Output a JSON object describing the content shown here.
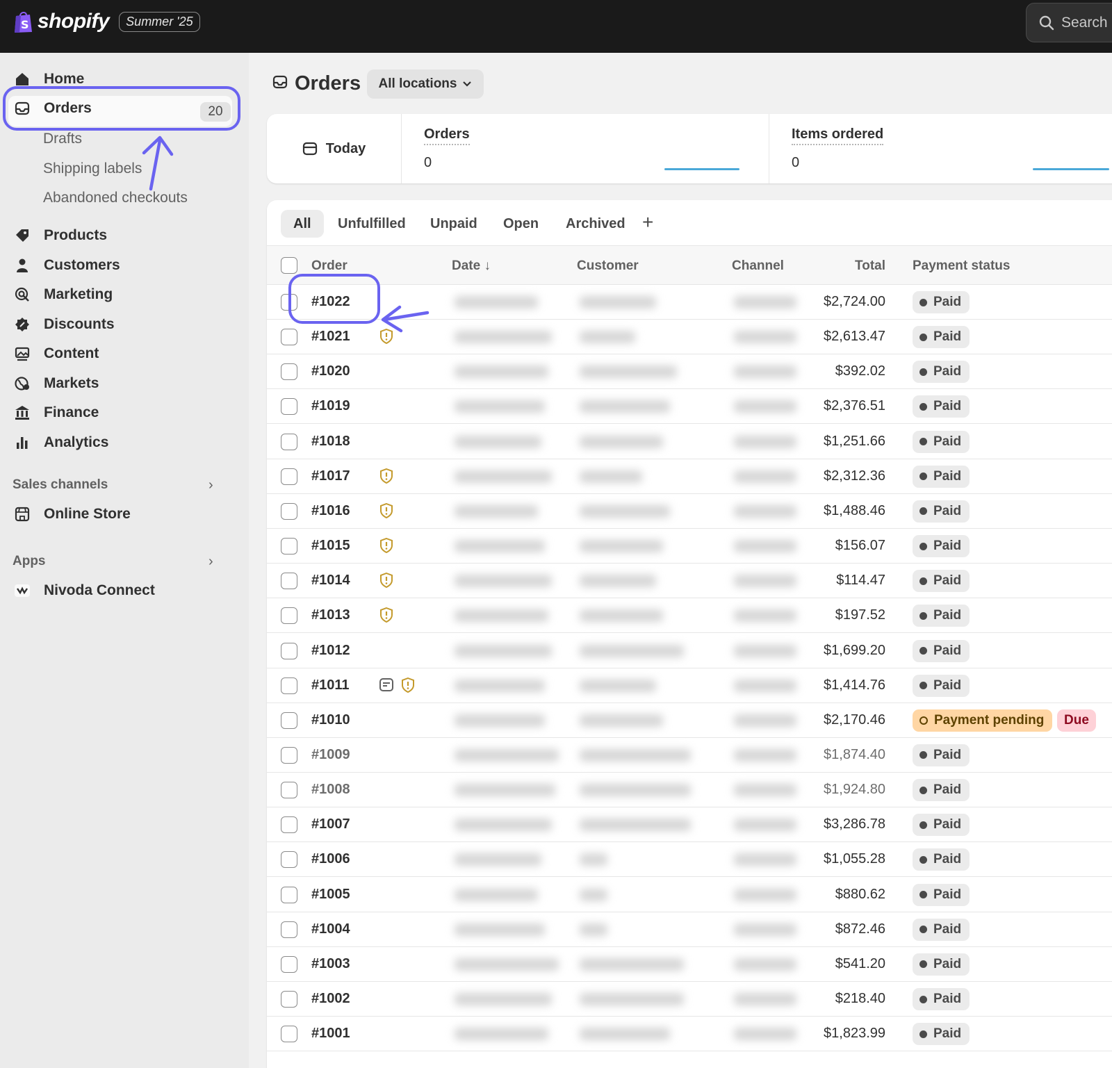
{
  "topbar": {
    "brand": "shopify",
    "edition": "Summer '25",
    "search_label": "Search"
  },
  "sidebar": {
    "items": [
      {
        "label": "Home",
        "icon": "home-icon"
      },
      {
        "label": "Orders",
        "icon": "orders-icon",
        "badge": "20"
      },
      {
        "label": "Products",
        "icon": "tag-icon"
      },
      {
        "label": "Customers",
        "icon": "person-icon"
      },
      {
        "label": "Marketing",
        "icon": "target-icon"
      },
      {
        "label": "Discounts",
        "icon": "discount-icon"
      },
      {
        "label": "Content",
        "icon": "image-icon"
      },
      {
        "label": "Markets",
        "icon": "globe-icon"
      },
      {
        "label": "Finance",
        "icon": "bank-icon"
      },
      {
        "label": "Analytics",
        "icon": "bar-chart-icon"
      }
    ],
    "orders_subitems": [
      "Drafts",
      "Shipping labels",
      "Abandoned checkouts"
    ],
    "sales_channels": {
      "heading": "Sales channels",
      "items": [
        "Online Store"
      ]
    },
    "apps": {
      "heading": "Apps",
      "items": [
        "Nivoda Connect"
      ]
    }
  },
  "main": {
    "title": "Orders",
    "location_filter": "All locations",
    "stats": {
      "period": "Today",
      "orders_label": "Orders",
      "orders_value": "0",
      "items_label": "Items ordered",
      "items_value": "0"
    },
    "tabs": [
      "All",
      "Unfulfilled",
      "Unpaid",
      "Open",
      "Archived"
    ],
    "active_tab": "All",
    "columns": [
      "Order",
      "Date ↓",
      "Customer",
      "Channel",
      "Total",
      "Payment status"
    ],
    "rows": [
      {
        "order": "#1022",
        "total": "$2,724.00",
        "status": "Paid"
      },
      {
        "order": "#1021",
        "total": "$2,613.47",
        "status": "Paid",
        "flags": [
          "risk"
        ]
      },
      {
        "order": "#1020",
        "total": "$392.02",
        "status": "Paid"
      },
      {
        "order": "#1019",
        "total": "$2,376.51",
        "status": "Paid"
      },
      {
        "order": "#1018",
        "total": "$1,251.66",
        "status": "Paid"
      },
      {
        "order": "#1017",
        "total": "$2,312.36",
        "status": "Paid",
        "flags": [
          "risk"
        ]
      },
      {
        "order": "#1016",
        "total": "$1,488.46",
        "status": "Paid",
        "flags": [
          "risk"
        ]
      },
      {
        "order": "#1015",
        "total": "$156.07",
        "status": "Paid",
        "flags": [
          "risk"
        ]
      },
      {
        "order": "#1014",
        "total": "$114.47",
        "status": "Paid",
        "flags": [
          "risk"
        ]
      },
      {
        "order": "#1013",
        "total": "$197.52",
        "status": "Paid",
        "flags": [
          "risk"
        ]
      },
      {
        "order": "#1012",
        "total": "$1,699.20",
        "status": "Paid"
      },
      {
        "order": "#1011",
        "total": "$1,414.76",
        "status": "Paid",
        "flags": [
          "note",
          "risk"
        ]
      },
      {
        "order": "#1010",
        "total": "$2,170.46",
        "status": "Payment pending",
        "extra_badge": "Due"
      },
      {
        "order": "#1009",
        "total": "$1,874.40",
        "status": "Paid",
        "muted": true
      },
      {
        "order": "#1008",
        "total": "$1,924.80",
        "status": "Paid",
        "muted": true
      },
      {
        "order": "#1007",
        "total": "$3,286.78",
        "status": "Paid"
      },
      {
        "order": "#1006",
        "total": "$1,055.28",
        "status": "Paid"
      },
      {
        "order": "#1005",
        "total": "$880.62",
        "status": "Paid"
      },
      {
        "order": "#1004",
        "total": "$872.46",
        "status": "Paid"
      },
      {
        "order": "#1003",
        "total": "$541.20",
        "status": "Paid"
      },
      {
        "order": "#1002",
        "total": "$218.40",
        "status": "Paid"
      },
      {
        "order": "#1001",
        "total": "$1,823.99",
        "status": "Paid"
      }
    ]
  },
  "colors": {
    "annotation": "#6a63f0",
    "risk_icon": "#c49a2c",
    "pending_bg": "#ffd6a4",
    "due_bg": "#fed1d7"
  }
}
